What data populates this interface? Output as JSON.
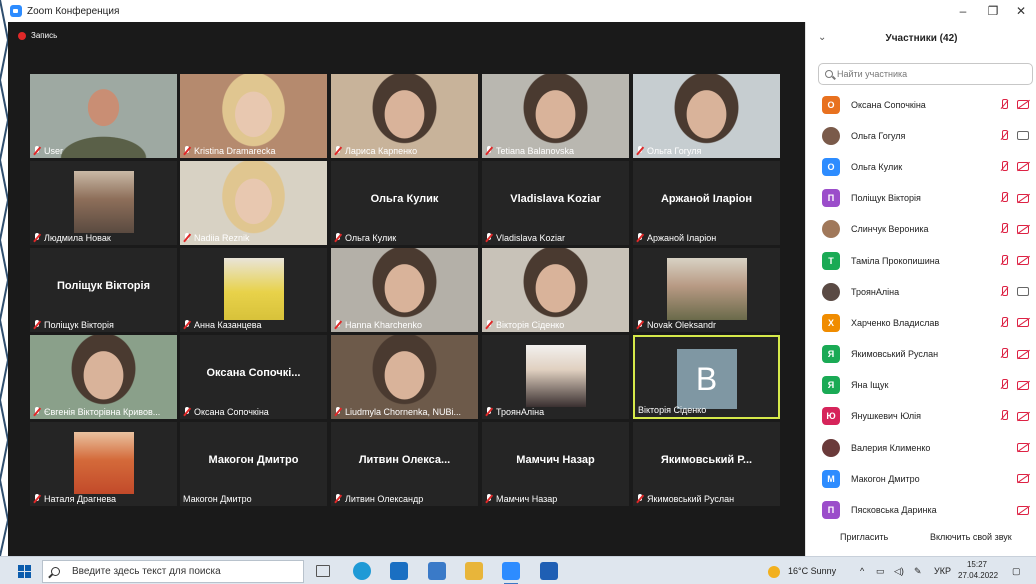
{
  "window": {
    "title": "Zoom Конференция"
  },
  "recording": {
    "label": "Запись"
  },
  "gallery": [
    {
      "label": "User",
      "display": "",
      "muted": true,
      "photo": "man-uniform",
      "bg": "#9ea9a2"
    },
    {
      "label": "Kristina Dramarecka",
      "display": "",
      "muted": true,
      "photo": "woman-blonde",
      "bg": "#b58a6e"
    },
    {
      "label": "Лариса Карпенко",
      "display": "",
      "muted": true,
      "photo": "woman-glasses",
      "bg": "#c8b39a"
    },
    {
      "label": "Tetiana Balanovska",
      "display": "",
      "muted": true,
      "photo": "woman-glasses-2",
      "bg": "#b9b7b0"
    },
    {
      "label": "Ольга Гогуля",
      "display": "",
      "muted": true,
      "photo": "woman-dark",
      "bg": "#c6cdd0"
    },
    {
      "label": "Людмила Новак",
      "display": "",
      "muted": true,
      "photo": "mini-woman",
      "bg": "#252525"
    },
    {
      "label": "Nadiia Reznik",
      "display": "",
      "muted": true,
      "photo": "woman-light",
      "bg": "#d8d2c4"
    },
    {
      "label": "Ольга Кулик",
      "display": "Ольга Кулик",
      "muted": true,
      "photo": "",
      "bg": "#252525"
    },
    {
      "label": "Vladislava Koziar",
      "display": "Vladislava Koziar",
      "muted": true,
      "photo": "",
      "bg": "#252525"
    },
    {
      "label": "Аржаной Іларіон",
      "display": "Аржаной Іларіон",
      "muted": true,
      "photo": "",
      "bg": "#252525"
    },
    {
      "label": "Поліщук Вікторія",
      "display": "Поліщук Вікторія",
      "muted": true,
      "photo": "",
      "bg": "#252525"
    },
    {
      "label": "Анна Казанцева",
      "display": "",
      "muted": true,
      "photo": "mini-yellow",
      "bg": "#252525"
    },
    {
      "label": "Hanna Kharchenko",
      "display": "",
      "muted": true,
      "photo": "woman-dark",
      "bg": "#b4b0a8"
    },
    {
      "label": "Вікторія Сіденко",
      "display": "",
      "muted": true,
      "photo": "woman-young",
      "bg": "#c8c2b8"
    },
    {
      "label": "Novak Oleksandr",
      "display": "",
      "muted": true,
      "photo": "mini-man",
      "bg": "#252525"
    },
    {
      "label": "Євгенія Вікторівна Кривов...",
      "display": "",
      "muted": true,
      "photo": "woman-window",
      "bg": "#8aa08a"
    },
    {
      "label": "Оксана Сопочкіна",
      "display": "Оксана  Сопочкі...",
      "muted": true,
      "photo": "",
      "bg": "#252525"
    },
    {
      "label": "Liudmyla Chornenka, NUBi...",
      "display": "",
      "muted": true,
      "photo": "woman-room",
      "bg": "#6d5a4a"
    },
    {
      "label": "ТроянАліна",
      "display": "",
      "muted": true,
      "photo": "mini-woman-2",
      "bg": "#252525"
    },
    {
      "label": "Вікторія Сіденко",
      "display": "",
      "muted": false,
      "photo": "avatar-B",
      "bg": "#252525",
      "avatar": "B",
      "active": true
    },
    {
      "label": "Наталя Драгнева",
      "display": "",
      "muted": true,
      "photo": "mini-red",
      "bg": "#252525"
    },
    {
      "label": "Макогон Дмитро",
      "display": "Макогон Дмитро",
      "muted": false,
      "photo": "",
      "bg": "#252525"
    },
    {
      "label": "Литвин Олександр",
      "display": "Литвин  Олекса...",
      "muted": true,
      "photo": "",
      "bg": "#252525"
    },
    {
      "label": "Мамчич Назар",
      "display": "Мамчич Назар",
      "muted": true,
      "photo": "",
      "bg": "#252525"
    },
    {
      "label": "Якимовський Руслан",
      "display": "Якимовський  Р...",
      "muted": true,
      "photo": "",
      "bg": "#252525"
    }
  ],
  "participants_panel": {
    "title": "Участники (42)",
    "search_placeholder": "Найти участника",
    "invite_label": "Пригласить",
    "unmute_label": "Включить свой звук",
    "items": [
      {
        "name": "Оксана Сопочкіна",
        "initial": "О",
        "color": "#e8711f",
        "photo": false,
        "mic_muted": true,
        "video_on": false
      },
      {
        "name": "Ольга Гогуля",
        "initial": "",
        "color": "#7a5a4a",
        "photo": true,
        "mic_muted": true,
        "video_on": true
      },
      {
        "name": "Ольга Кулик",
        "initial": "О",
        "color": "#2d8cff",
        "photo": false,
        "mic_muted": true,
        "video_on": false
      },
      {
        "name": "Поліщук Вікторія",
        "initial": "П",
        "color": "#9b4dca",
        "photo": false,
        "mic_muted": true,
        "video_on": false
      },
      {
        "name": "Слинчук Вероника",
        "initial": "",
        "color": "#a0785a",
        "photo": true,
        "mic_muted": true,
        "video_on": false
      },
      {
        "name": "Таміла Прокопишина",
        "initial": "Т",
        "color": "#1aaa55",
        "photo": false,
        "mic_muted": true,
        "video_on": false
      },
      {
        "name": "ТроянАліна",
        "initial": "",
        "color": "#5a4a44",
        "photo": true,
        "mic_muted": true,
        "video_on": true
      },
      {
        "name": "Харченко Владислав",
        "initial": "Х",
        "color": "#f08c00",
        "photo": false,
        "mic_muted": true,
        "video_on": false
      },
      {
        "name": "Якимовський Руслан",
        "initial": "Я",
        "color": "#1aaa55",
        "photo": false,
        "mic_muted": true,
        "video_on": false
      },
      {
        "name": "Яна Іщук",
        "initial": "Я",
        "color": "#1aaa55",
        "photo": false,
        "mic_muted": true,
        "video_on": false
      },
      {
        "name": "Янушкевич Юлія",
        "initial": "Ю",
        "color": "#d6245a",
        "photo": false,
        "mic_muted": true,
        "video_on": false
      },
      {
        "name": "Валерия Клименко",
        "initial": "",
        "color": "#6a3a3a",
        "photo": true,
        "mic_muted": false,
        "video_on": false
      },
      {
        "name": "Макогон Дмитро",
        "initial": "М",
        "color": "#2d8cff",
        "photo": false,
        "mic_muted": false,
        "video_on": false
      },
      {
        "name": "Пясковська Даринка",
        "initial": "П",
        "color": "#9b4dca",
        "photo": false,
        "mic_muted": false,
        "video_on": false
      }
    ]
  },
  "taskbar": {
    "search_placeholder": "Введите здесь текст для поиска",
    "weather": "16°C  Sunny",
    "language": "УКР",
    "time": "15:27",
    "date": "27.04.2022"
  }
}
